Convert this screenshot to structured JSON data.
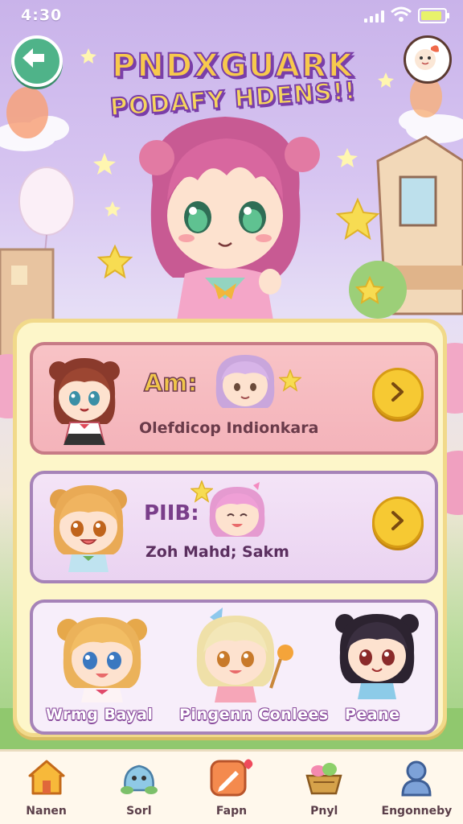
{
  "status_bar": {
    "time": "4:30"
  },
  "header": {
    "title_line1": "PNDXGUARK",
    "title_line2": "PODAFY HDENS!!"
  },
  "cards": [
    {
      "label": "Am:",
      "subtitle": "Olefdicop Indionkara"
    },
    {
      "label": "PIIB:",
      "subtitle": "Zoh Mahd; Sakm"
    }
  ],
  "characters": [
    {
      "name": "Wrmg Bayal"
    },
    {
      "name": "Pingenn Conlees"
    },
    {
      "name": "Peane"
    }
  ],
  "nav": [
    {
      "label": "Nanen",
      "icon": "house-icon"
    },
    {
      "label": "Sorl",
      "icon": "blob-icon"
    },
    {
      "label": "Fapn",
      "icon": "pencil-icon"
    },
    {
      "label": "Pnyl",
      "icon": "basket-icon"
    },
    {
      "label": "Engonneby",
      "icon": "person-icon"
    }
  ],
  "colors": {
    "accent": "#f6c933",
    "panel": "#fdf6c9",
    "card_pink": "#f4b3ba",
    "card_lilac": "#ead3f1"
  }
}
